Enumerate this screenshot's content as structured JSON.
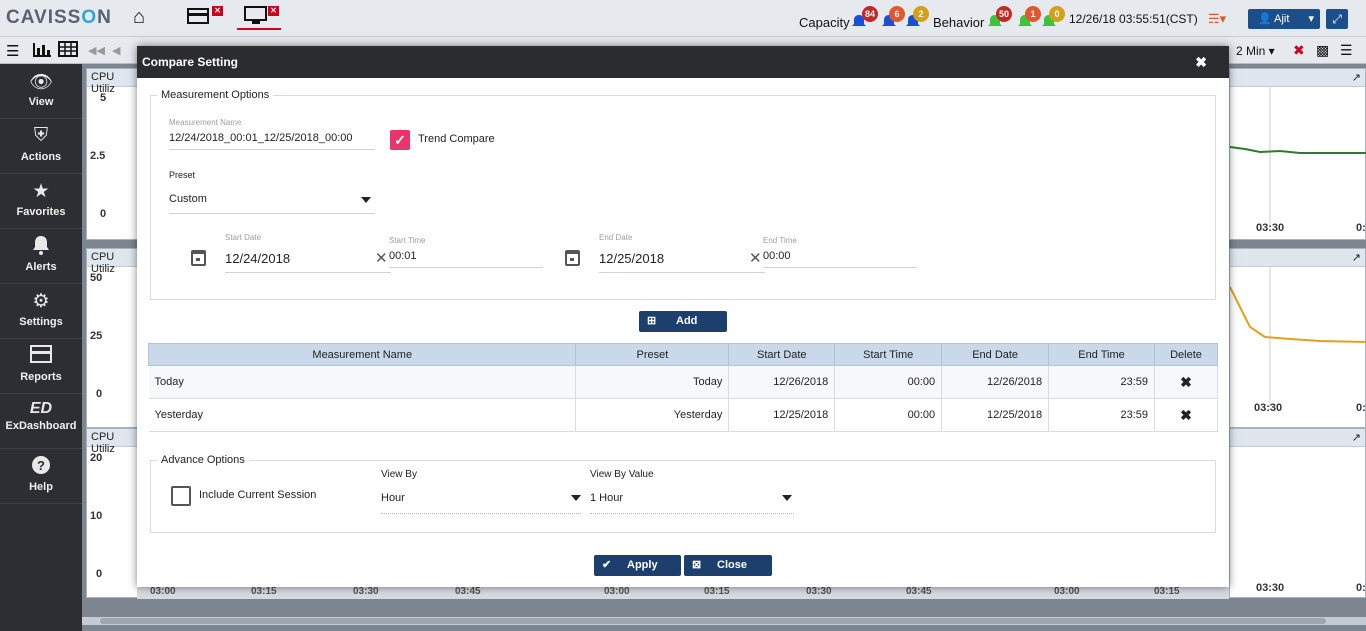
{
  "app": {
    "logo": "CAVISSON",
    "capacity_label": "Capacity",
    "capacity_badges": [
      "84",
      "6",
      "2"
    ],
    "behavior_label": "Behavior",
    "behavior_badges": [
      "50",
      "1",
      "0"
    ],
    "clock": "12/26/18 03:55:51(CST)",
    "user": "Ajit",
    "interval": "2 Min"
  },
  "sidebar": {
    "items": [
      {
        "label": "View"
      },
      {
        "label": "Actions"
      },
      {
        "label": "Favorites"
      },
      {
        "label": "Alerts"
      },
      {
        "label": "Settings"
      },
      {
        "label": "Reports"
      },
      {
        "label": "ExDashboard"
      },
      {
        "label": "Help"
      }
    ]
  },
  "background": {
    "panel_title": "CPU Utiliz",
    "p1_y": [
      "5",
      "2.5",
      "0"
    ],
    "p2_y": [
      "50",
      "25",
      "0"
    ],
    "p3_y": [
      "20",
      "10",
      "0"
    ],
    "x_labels": [
      "03:00",
      "03:15",
      "03:30",
      "03:45"
    ],
    "right_x": [
      "03:30",
      "0:"
    ]
  },
  "modal": {
    "title": "Compare Setting",
    "measurement_legend": "Measurement Options",
    "measurement_name_label": "Measurement Name",
    "measurement_name_value": "12/24/2018_00:01_12/25/2018_00:00",
    "trend_compare_label": "Trend Compare",
    "preset_label": "Preset",
    "preset_value": "Custom",
    "start_date_label": "Start Date",
    "start_date_value": "12/24/2018",
    "start_time_label": "Start Time",
    "start_time_value": "00:01",
    "end_date_label": "End Date",
    "end_date_value": "12/25/2018",
    "end_time_label": "End Time",
    "end_time_value": "00:00",
    "add_label": "Add",
    "table": {
      "headers": [
        "Measurement Name",
        "Preset",
        "Start Date",
        "Start Time",
        "End Date",
        "End Time",
        "Delete"
      ],
      "rows": [
        {
          "name": "Today",
          "preset": "Today",
          "start_date": "12/26/2018",
          "start_time": "00:00",
          "end_date": "12/26/2018",
          "end_time": "23:59"
        },
        {
          "name": "Yesterday",
          "preset": "Yesterday",
          "start_date": "12/25/2018",
          "start_time": "00:00",
          "end_date": "12/25/2018",
          "end_time": "23:59"
        }
      ]
    },
    "advance_legend": "Advance Options",
    "include_session_label": "Include Current Session",
    "view_by_label": "View By",
    "view_by_value": "Hour",
    "view_by_value_label": "View By Value",
    "view_by_value_value": "1 Hour",
    "apply_label": "Apply",
    "close_label": "Close"
  },
  "colors": {
    "header": "#2b2c2f",
    "accent": "#1c3f6e",
    "checkbox": "#e8336b",
    "table_header": "#c9d9ea"
  }
}
